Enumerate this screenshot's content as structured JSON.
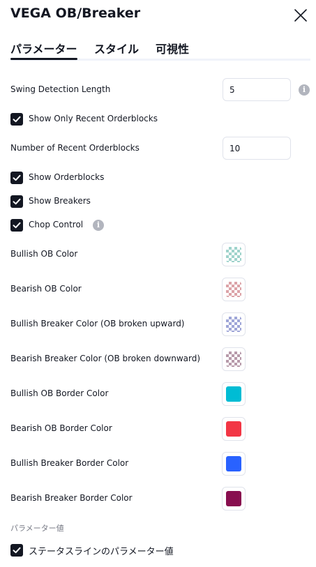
{
  "dialog": {
    "title": "VEGA OB/Breaker"
  },
  "tabs": [
    {
      "label": "パラメーター"
    },
    {
      "label": "スタイル"
    },
    {
      "label": "可視性"
    }
  ],
  "inputs": {
    "swing_label": "Swing Detection Length",
    "swing_value": "5",
    "show_recent_label": "Show Only Recent Orderblocks",
    "show_recent_checked": true,
    "num_recent_label": "Number of Recent Orderblocks",
    "num_recent_value": "10",
    "show_ob_label": "Show Orderblocks",
    "show_ob_checked": true,
    "show_breakers_label": "Show Breakers",
    "show_breakers_checked": true,
    "chop_label": "Chop Control",
    "chop_checked": true
  },
  "colors": [
    {
      "label": "Bullish OB Color",
      "color": "#9fd3cc",
      "pattern": "checker"
    },
    {
      "label": "Bearish OB Color",
      "color": "#dca3a8",
      "pattern": "checker"
    },
    {
      "label": "Bullish Breaker Color (OB broken upward)",
      "color": "#9fa6d8",
      "pattern": "checker"
    },
    {
      "label": "Bearish Breaker Color (OB broken downward)",
      "color": "#b79aaa",
      "pattern": "checker"
    },
    {
      "label": "Bullish OB Border Color",
      "color": "#00bcd4",
      "pattern": "solid"
    },
    {
      "label": "Bearish OB Border Color",
      "color": "#f23645",
      "pattern": "solid"
    },
    {
      "label": "Bullish Breaker Border Color",
      "color": "#2962ff",
      "pattern": "solid"
    },
    {
      "label": "Bearish Breaker Border Color",
      "color": "#880e4f",
      "pattern": "solid"
    }
  ],
  "footer": {
    "section_title": "パラメーター値",
    "status_line_label": "ステータスラインのパラメーター値",
    "status_line_checked": true
  }
}
